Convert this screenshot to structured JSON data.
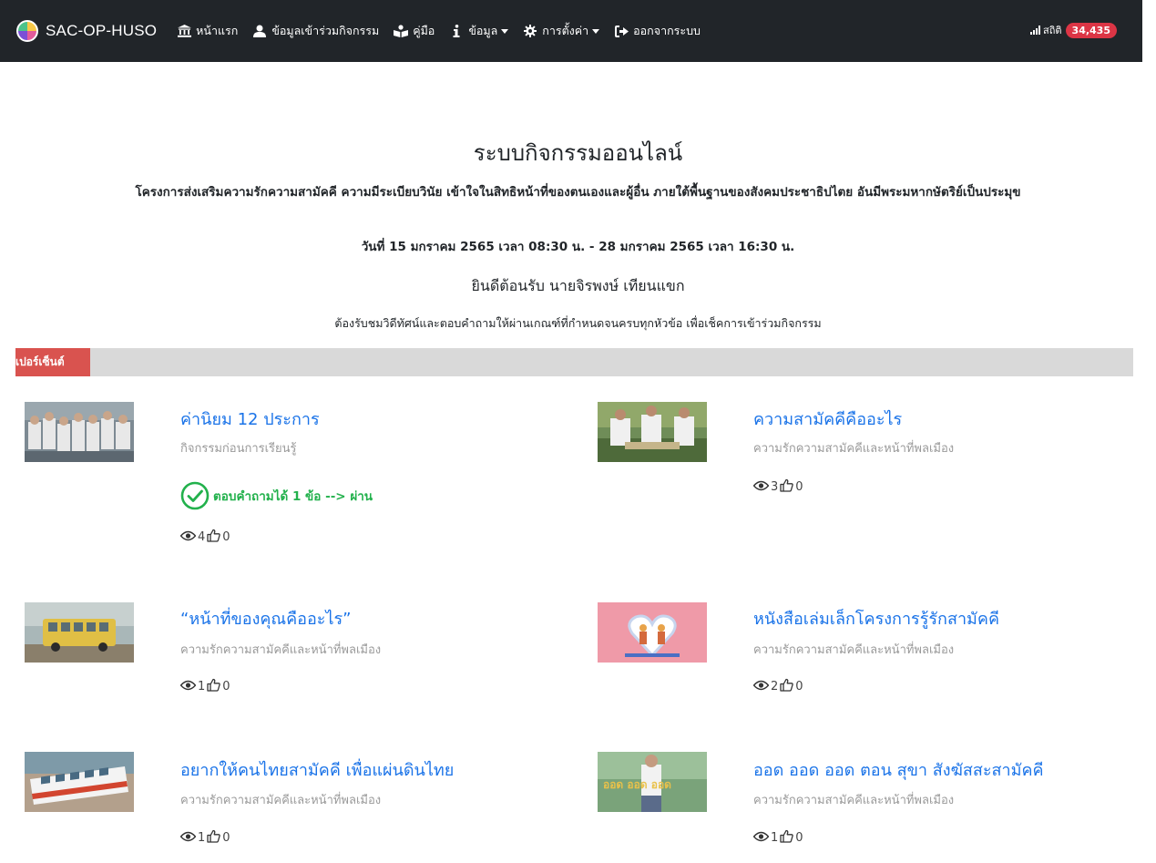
{
  "navbar": {
    "brand": "SAC-OP-HUSO",
    "items": [
      {
        "label": "หน้าแรก",
        "icon": "university-icon",
        "dropdown": false
      },
      {
        "label": "ข้อมูลเข้าร่วมกิจกรรม",
        "icon": "user-icon",
        "dropdown": false
      },
      {
        "label": "คู่มือ",
        "icon": "book-reader-icon",
        "dropdown": false
      },
      {
        "label": "ข้อมูล",
        "icon": "info-icon",
        "dropdown": true
      },
      {
        "label": "การตั้งค่า",
        "icon": "gear-icon",
        "dropdown": true
      },
      {
        "label": "ออกจากระบบ",
        "icon": "sign-out-icon",
        "dropdown": false
      }
    ],
    "stats_label": "สถิติ",
    "stats_count": "34,435"
  },
  "header": {
    "title": "ระบบกิจกรรมออนไลน์",
    "subtitle": "โครงการส่งเสริมความรักความสามัคคี ความมีระเบียบวินัย เข้าใจในสิทธิหน้าที่ของตนเองและผู้อื่น ภายใต้พื้นฐานของสังคมประชาธิปไตย อันมีพระมหากษัตริย์เป็นประมุข",
    "date": "วันที่ 15 มกราคม 2565 เวลา 08:30 น. - 28 มกราคม 2565 เวลา 16:30 น.",
    "welcome": "ยินดีต้อนรับ นายจิรพงษ์ เทียนแขก",
    "instruction": "ต้องรับชมวิดีทัศน์และตอบคำถามให้ผ่านเกณฑ์ที่กำหนดจนครบทุกหัวข้อ เพื่อเช็คการเข้าร่วมกิจกรรม"
  },
  "progress": {
    "label": "เปอร์เซ็นต์",
    "fraction": 0.067,
    "fill_color": "#d9534f",
    "track_color": "#d9d9d9"
  },
  "activities": [
    {
      "title": "ค่านิยม 12 ประการ",
      "category": "กิจกรรมก่อนการเรียนรู้",
      "pass_text": "ตอบคำถามได้ 1 ข้อ --> ผ่าน",
      "views": "4",
      "likes": "0"
    },
    {
      "title": "ความสามัคคีคืออะไร",
      "category": "ความรักความสามัคคีและหน้าที่พลเมือง",
      "views": "3",
      "likes": "0"
    },
    {
      "title": "“หน้าที่ของคุณคืออะไร”",
      "category": "ความรักความสามัคคีและหน้าที่พลเมือง",
      "views": "1",
      "likes": "0"
    },
    {
      "title": "หนังสือเล่มเล็กโครงการรู้รักสามัคคี",
      "category": "ความรักความสามัคคีและหน้าที่พลเมือง",
      "views": "2",
      "likes": "0"
    },
    {
      "title": "อยากให้คนไทยสามัคคี เพื่อแผ่นดินไทย",
      "category": "ความรักความสามัคคีและหน้าที่พลเมือง",
      "views": "1",
      "likes": "0"
    },
    {
      "title": "ออด ออด ออด ตอน สุขา สังฆัสสะสามัคคี",
      "category": "ความรักความสามัคคีและหน้าที่พลเมือง",
      "views": "1",
      "likes": "0"
    }
  ],
  "colors": {
    "navbar_bg": "#212529",
    "link": "#1a73e8",
    "pass_green": "#22b14c",
    "badge_red": "#dc3545"
  }
}
